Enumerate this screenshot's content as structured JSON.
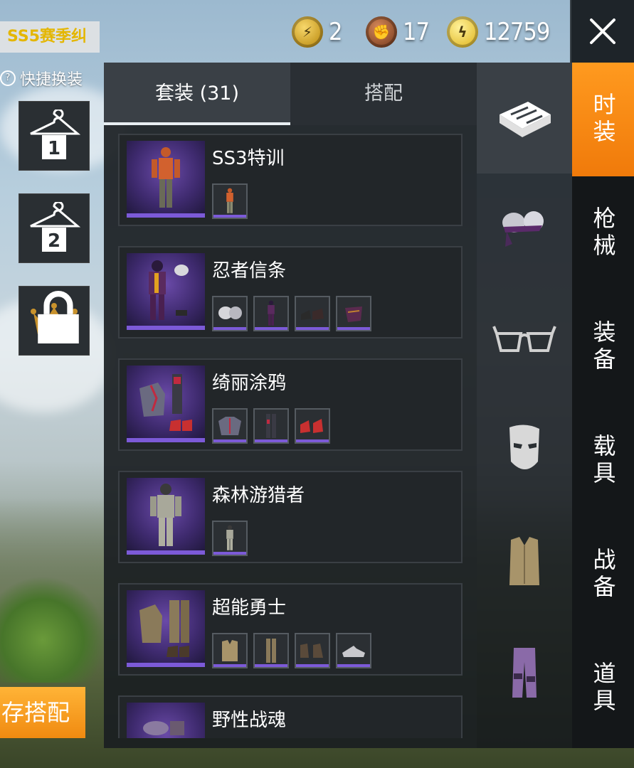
{
  "currencies": [
    {
      "icon": "ag-coin-icon",
      "value": "2"
    },
    {
      "icon": "bp-coin-icon",
      "value": "17"
    },
    {
      "icon": "uc-coin-icon",
      "value": "12759"
    }
  ],
  "season_tag": "SS5赛季纠",
  "quick_change_label": "快捷换装",
  "slots": [
    {
      "icon": "hanger-icon",
      "number": "1"
    },
    {
      "icon": "hanger-icon",
      "number": "2"
    },
    {
      "icon": "crown-icon",
      "locked": true
    }
  ],
  "save_button_label": "存搭配",
  "tabs": [
    {
      "label": "套装 (31)",
      "active": true
    },
    {
      "label": "搭配",
      "active": false
    }
  ],
  "outfits": [
    {
      "name": "SS3特训",
      "item_icons": [
        "outfit-figure-icon"
      ]
    },
    {
      "name": "忍者信条",
      "item_icons": [
        "helmet-icon",
        "outfit-figure-icon",
        "shoes-icon",
        "mask-icon"
      ]
    },
    {
      "name": "绮丽涂鸦",
      "item_icons": [
        "jacket-icon",
        "pants-icon",
        "shoes-icon"
      ]
    },
    {
      "name": "森林游猎者",
      "item_icons": [
        "outfit-figure-icon"
      ]
    },
    {
      "name": "超能勇士",
      "item_icons": [
        "vest-icon",
        "pants-icon",
        "boots-icon",
        "shoes-icon"
      ]
    },
    {
      "name": "野性战魂",
      "item_icons": []
    }
  ],
  "icon_column": [
    "outfit-box-icon",
    "hair-icon",
    "glasses-icon",
    "mask-icon",
    "vest-icon",
    "pants-icon"
  ],
  "categories": [
    {
      "label": "时装",
      "active": true
    },
    {
      "label": "枪械",
      "active": false
    },
    {
      "label": "装备",
      "active": false
    },
    {
      "label": "载具",
      "active": false
    },
    {
      "label": "战备",
      "active": false
    },
    {
      "label": "道具",
      "active": false
    }
  ],
  "colors": {
    "accent_orange": "#f08a10",
    "rarity_purple": "#7c5ad8",
    "season_yellow": "#e4b600"
  }
}
